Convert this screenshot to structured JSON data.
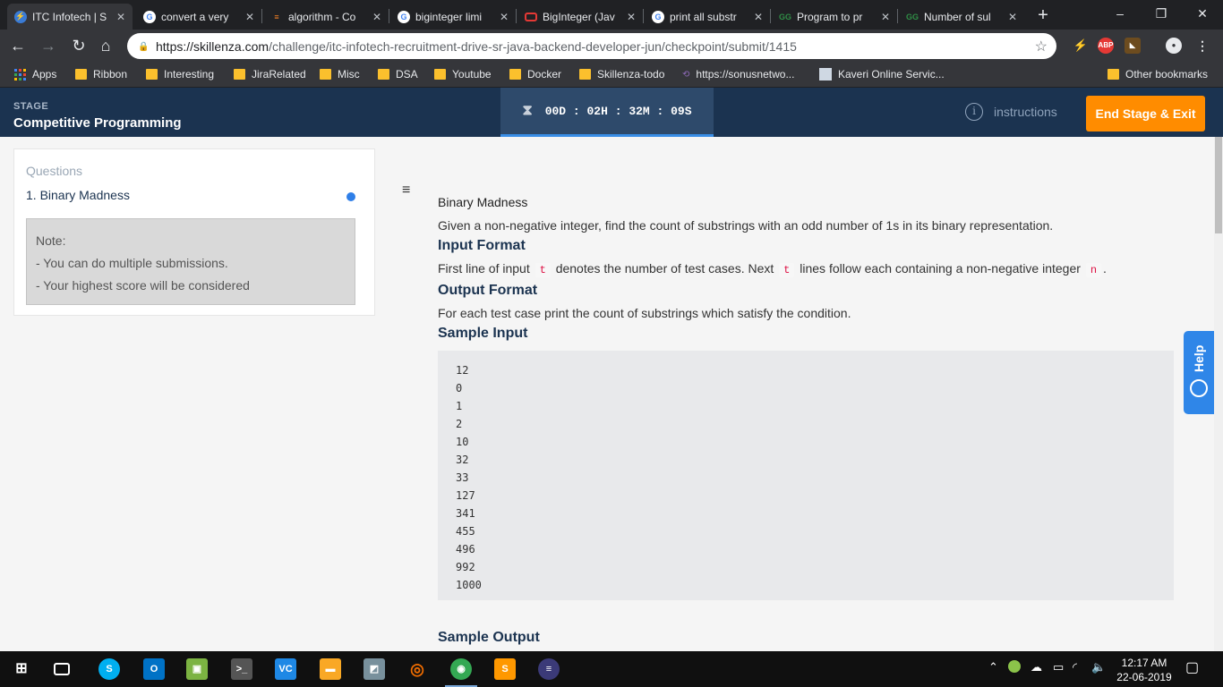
{
  "browser": {
    "tabs": [
      {
        "title": "ITC Infotech | S",
        "favicon": "skillenza",
        "active": true
      },
      {
        "title": "convert a very",
        "favicon": "google"
      },
      {
        "title": "algorithm - Co",
        "favicon": "stackoverflow"
      },
      {
        "title": "biginteger limi",
        "favicon": "google"
      },
      {
        "title": "BigInteger (Jav",
        "favicon": "oracle"
      },
      {
        "title": "print all substr",
        "favicon": "google"
      },
      {
        "title": "Program to pr",
        "favicon": "geeksforgeeks"
      },
      {
        "title": "Number of sul",
        "favicon": "geeksforgeeks"
      }
    ],
    "new_tab": "+",
    "window_controls": {
      "minimize": "–",
      "restore": "❐",
      "close": "✕"
    },
    "url_host": "https://skillenza.com",
    "url_path": "/challenge/itc-infotech-recruitment-drive-sr-java-backend-developer-jun/checkpoint/submit/1415",
    "extensions": {
      "abp": "ABP"
    },
    "bookmarks": [
      {
        "label": "Apps",
        "icon": "apps-grid"
      },
      {
        "label": "Ribbon",
        "icon": "folder"
      },
      {
        "label": "Interesting",
        "icon": "folder"
      },
      {
        "label": "JiraRelated",
        "icon": "folder"
      },
      {
        "label": "Misc",
        "icon": "folder"
      },
      {
        "label": "DSA",
        "icon": "folder"
      },
      {
        "label": "Youtube",
        "icon": "folder"
      },
      {
        "label": "Docker",
        "icon": "folder"
      },
      {
        "label": "Skillenza-todo",
        "icon": "folder"
      },
      {
        "label": "https://sonusnetwo...",
        "icon": "link"
      },
      {
        "label": "Kaveri Online Servic...",
        "icon": "page"
      }
    ],
    "other_bookmarks": "Other bookmarks"
  },
  "stage": {
    "label": "STAGE",
    "name": "Competitive Programming",
    "timer": "00D : 02H : 32M : 09S",
    "instructions": "instructions",
    "end_button": "End Stage & Exit"
  },
  "sidebar": {
    "heading": "Questions",
    "question": "1. Binary Madness",
    "note_title": "Note:",
    "note_lines": [
      "- You can do multiple submissions.",
      "- Your highest score will be considered"
    ]
  },
  "problem": {
    "title": "Binary Madness",
    "description": "Given a non-negative integer, find the count of substrings with an odd number of 1s in its binary representation.",
    "input_heading": "Input Format",
    "input_text_1": "First line of input",
    "input_code_t": "t",
    "input_text_2": "denotes the number of test cases. Next",
    "input_text_3": "lines follow each containing a non-negative integer",
    "input_code_n": "n",
    "input_text_end": ".",
    "output_heading": "Output Format",
    "output_text": "For each test case print the count of substrings which satisfy the condition.",
    "sample_input_heading": "Sample Input",
    "sample_input": "12\n0\n1\n2\n10\n32\n33\n127\n341\n455\n496\n992\n1000",
    "sample_output_heading": "Sample Output"
  },
  "help": {
    "label": "Help"
  },
  "taskbar": {
    "apps": [
      "windows-start",
      "task-view",
      "skype",
      "outlook",
      "vmware",
      "terminal",
      "vscode",
      "file-explorer",
      "sticky-notes",
      "postman",
      "chrome",
      "sublime",
      "eclipse"
    ],
    "time": "12:17 AM",
    "date": "22-06-2019"
  },
  "colors": {
    "accent": "#ff8c00",
    "header": "#1b3350",
    "help": "#2f86e8",
    "dot": "#2f7fe8"
  }
}
